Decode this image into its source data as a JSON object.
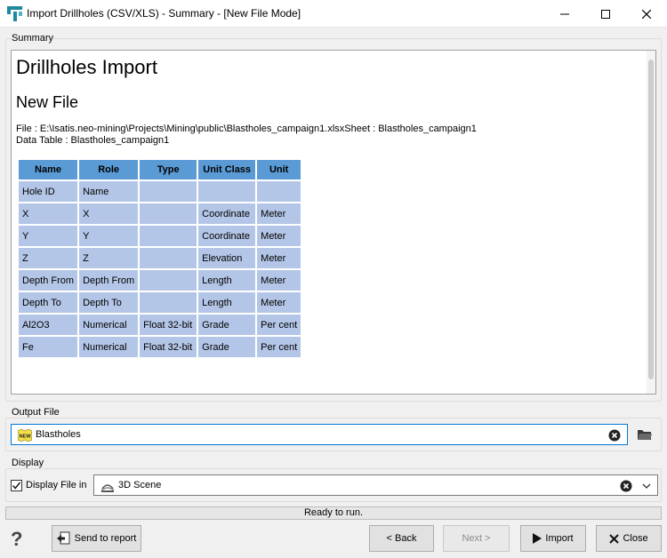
{
  "window": {
    "title": "Import Drillholes (CSV/XLS) - Summary - [New File Mode]"
  },
  "summary": {
    "group_label": "Summary",
    "heading": "Drillholes Import",
    "subheading": "New File",
    "file_line": "File : E:\\Isatis.neo-mining\\Projects\\Mining\\public\\Blastholes_campaign1.xlsxSheet : Blastholes_campaign1",
    "data_table_line": "Data Table : Blastholes_campaign1",
    "table": {
      "headers": [
        "Name",
        "Role",
        "Type",
        "Unit Class",
        "Unit"
      ],
      "rows": [
        [
          "Hole ID",
          "Name",
          "",
          "",
          ""
        ],
        [
          "X",
          "X",
          "",
          "Coordinate",
          "Meter"
        ],
        [
          "Y",
          "Y",
          "",
          "Coordinate",
          "Meter"
        ],
        [
          "Z",
          "Z",
          "",
          "Elevation",
          "Meter"
        ],
        [
          "Depth From",
          "Depth From",
          "",
          "Length",
          "Meter"
        ],
        [
          "Depth To",
          "Depth To",
          "",
          "Length",
          "Meter"
        ],
        [
          "Al2O3",
          "Numerical",
          "Float 32-bit",
          "Grade",
          "Per cent"
        ],
        [
          "Fe",
          "Numerical",
          "Float 32-bit",
          "Grade",
          "Per cent"
        ]
      ]
    }
  },
  "output_file": {
    "group_label": "Output File",
    "badge": "NEW",
    "value": "Blastholes"
  },
  "display": {
    "group_label": "Display",
    "checkbox_label": "Display File in",
    "checked": true,
    "selected": "3D Scene"
  },
  "status": "Ready to run.",
  "buttons": {
    "send_to_report": "Send to report",
    "back": "< Back",
    "next": "Next >",
    "import": "Import",
    "close": "Close"
  },
  "colors": {
    "header_bg": "#5b9bd5",
    "cell_bg": "#b4c6e7",
    "focus": "#0078d7"
  }
}
